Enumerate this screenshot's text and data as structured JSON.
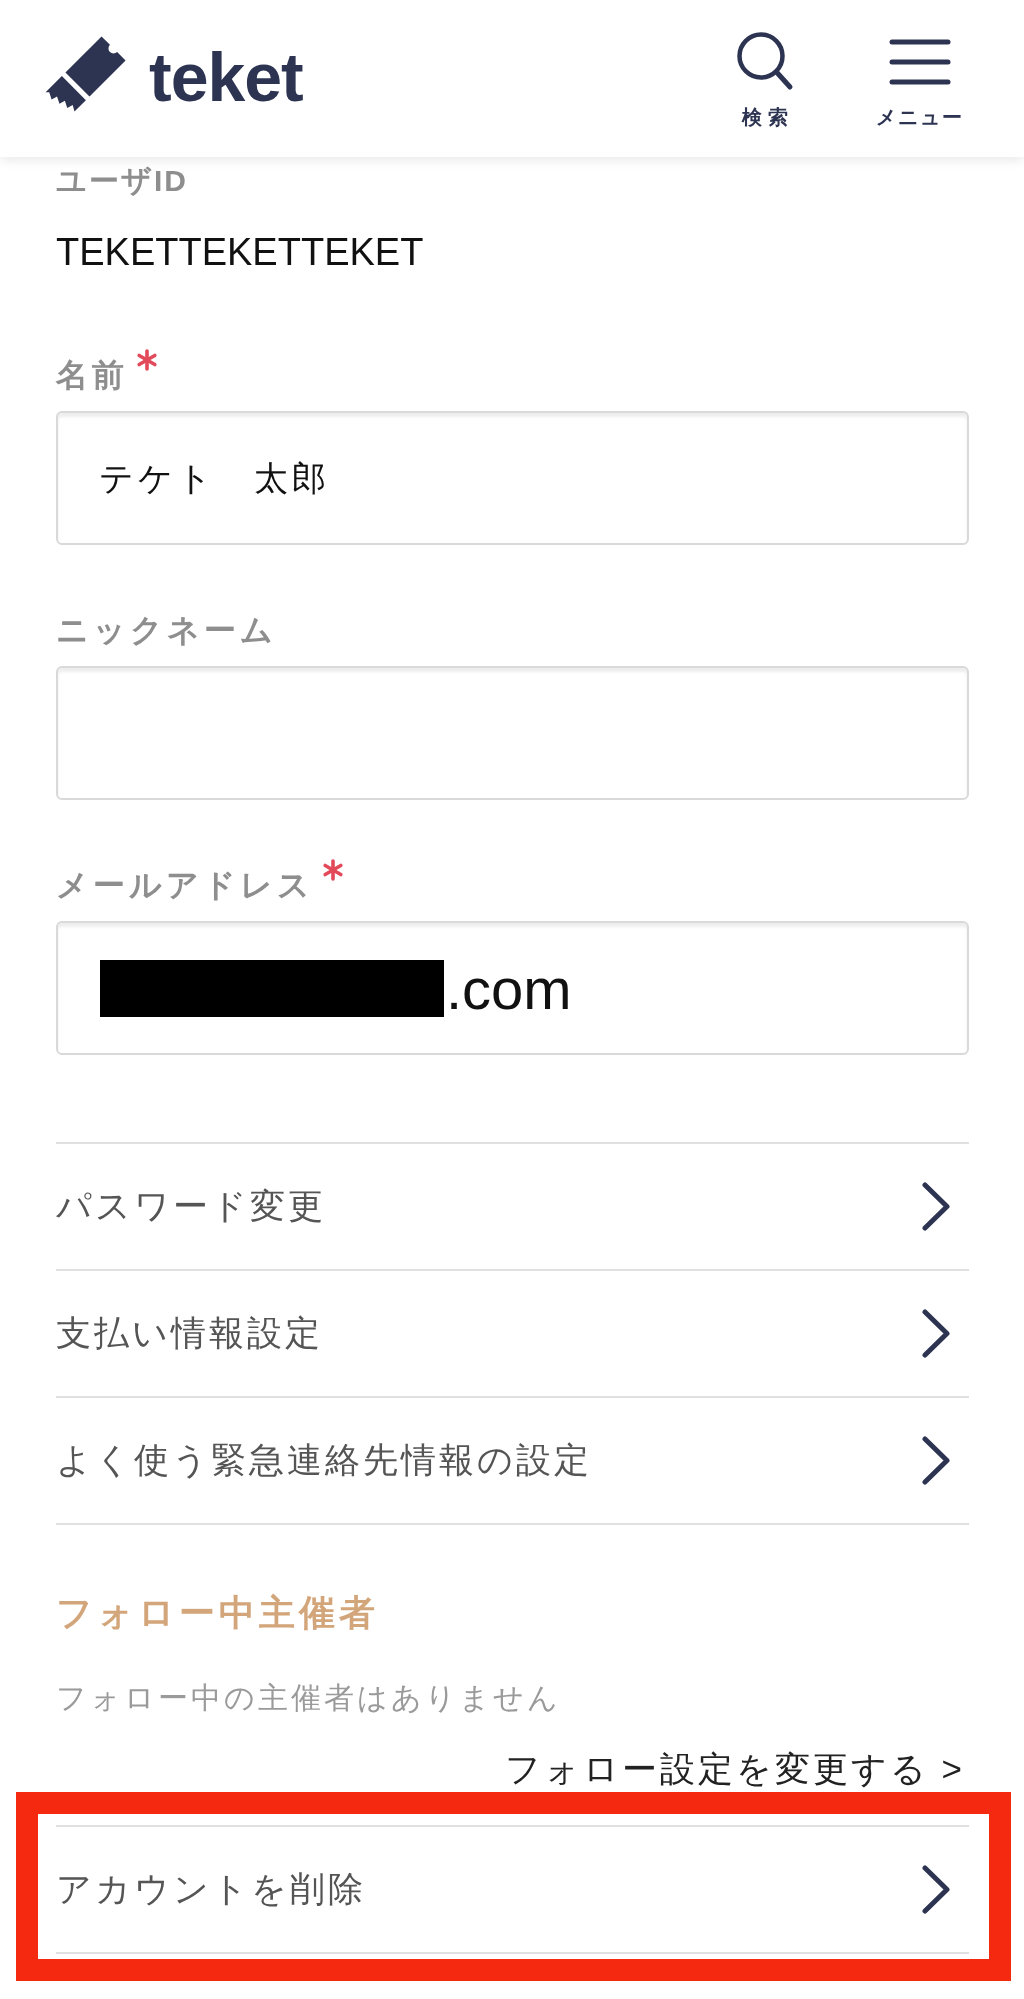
{
  "header": {
    "logo_text": "teket",
    "actions": [
      {
        "kind": "search",
        "label": "検索"
      },
      {
        "kind": "menu",
        "label": "メニュー"
      }
    ]
  },
  "profile": {
    "user_id": {
      "label": "ユーザID",
      "value": "TEKETTEKETTEKET"
    },
    "fields": [
      {
        "label": "名前",
        "required": true,
        "value": "テケト　太郎"
      },
      {
        "label": "ニックネーム",
        "required": false
      },
      {
        "label": "メールアドレス",
        "required": true,
        "value": ".com",
        "redacted": true
      }
    ]
  },
  "settings_links": [
    {
      "label": "パスワード変更"
    },
    {
      "label": "支払い情報設定"
    },
    {
      "label": "よく使う緊急連絡先情報の設定"
    }
  ],
  "following": {
    "title": "フォロー中主催者",
    "empty_message": "フォロー中の主催者はありません",
    "link": "フォロー設定を変更する >"
  },
  "account_actions": [
    {
      "label": "アカウントを削除",
      "highlighted": true
    }
  ]
}
